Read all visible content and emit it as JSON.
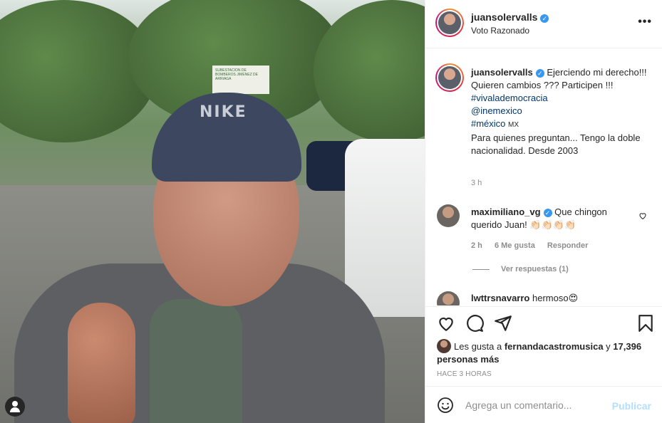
{
  "post": {
    "header": {
      "username": "juansolervalls",
      "subtitle": "Voto Razonado",
      "verified": true
    },
    "photo": {
      "cap_text": "NIKE",
      "sign_text": "SUBESTACION DE BOMBEROS JIMENEZ DE ARRIAGA"
    },
    "caption": {
      "username": "juansolervalls",
      "text_line1": "Ejerciendo mi derecho!!! Quieren cambios ??? Participen !!!",
      "tag1": "#vivalademocracia",
      "tag2": "@inemexico",
      "tag3": "#méxico",
      "flag": "MX",
      "text_line2": "Para quienes preguntan... Tengo la doble nacionalidad. Desde 2003",
      "time": "3 h"
    },
    "comments": [
      {
        "username": "maximiliano_vg",
        "text": "Que chingon querido Juan! 👏🏻👏🏻👏🏻👏🏻",
        "time": "2 h",
        "likes": "6 Me gusta",
        "reply": "Responder",
        "view_replies": "Ver respuestas (1)"
      },
      {
        "username": "lwttrsnavarro",
        "text": "hermoso😍"
      }
    ],
    "likes": {
      "prefix": "Les gusta a ",
      "user": "fernandacastromusica",
      "middle": " y ",
      "count": "17,396 personas más"
    },
    "posted_ago": "HACE 3 HORAS",
    "comment_box": {
      "placeholder": "Agrega un comentario...",
      "publish_label": "Publicar"
    }
  },
  "icons": {
    "heart": "heart-icon",
    "comment": "comment-icon",
    "share": "share-icon",
    "save": "bookmark-icon",
    "emoji": "emoji-icon",
    "more": "more-icon",
    "user": "user-tag-icon"
  },
  "colors": {
    "link": "#00376b",
    "verified": "#3897f0",
    "muted": "#8e8e8e",
    "publish_disabled": "#b2dffc"
  }
}
